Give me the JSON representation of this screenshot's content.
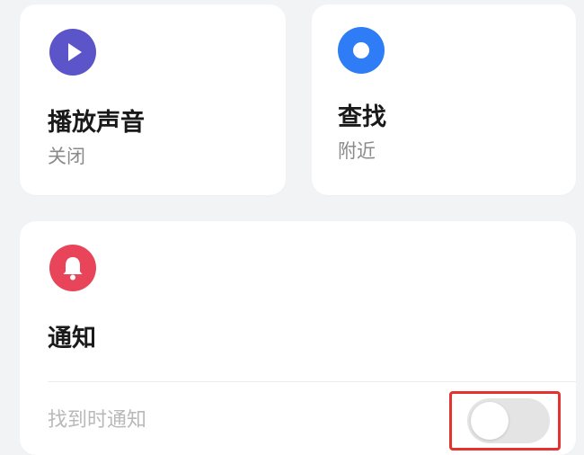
{
  "cards": {
    "play_sound": {
      "title": "播放声音",
      "status": "关闭",
      "icon": "play-icon",
      "icon_color": "#5b55c9"
    },
    "find": {
      "title": "查找",
      "status": "附近",
      "icon": "target-icon",
      "icon_color": "#2f7df6"
    },
    "notify": {
      "title": "通知",
      "icon": "bell-icon",
      "icon_color": "#e9455a",
      "rows": [
        {
          "label": "找到时通知",
          "toggle_on": false
        }
      ]
    }
  },
  "colors": {
    "background": "#f2f3f5",
    "card": "#ffffff",
    "highlight": "#e6322f",
    "toggle_off": "#e4e4e4"
  }
}
